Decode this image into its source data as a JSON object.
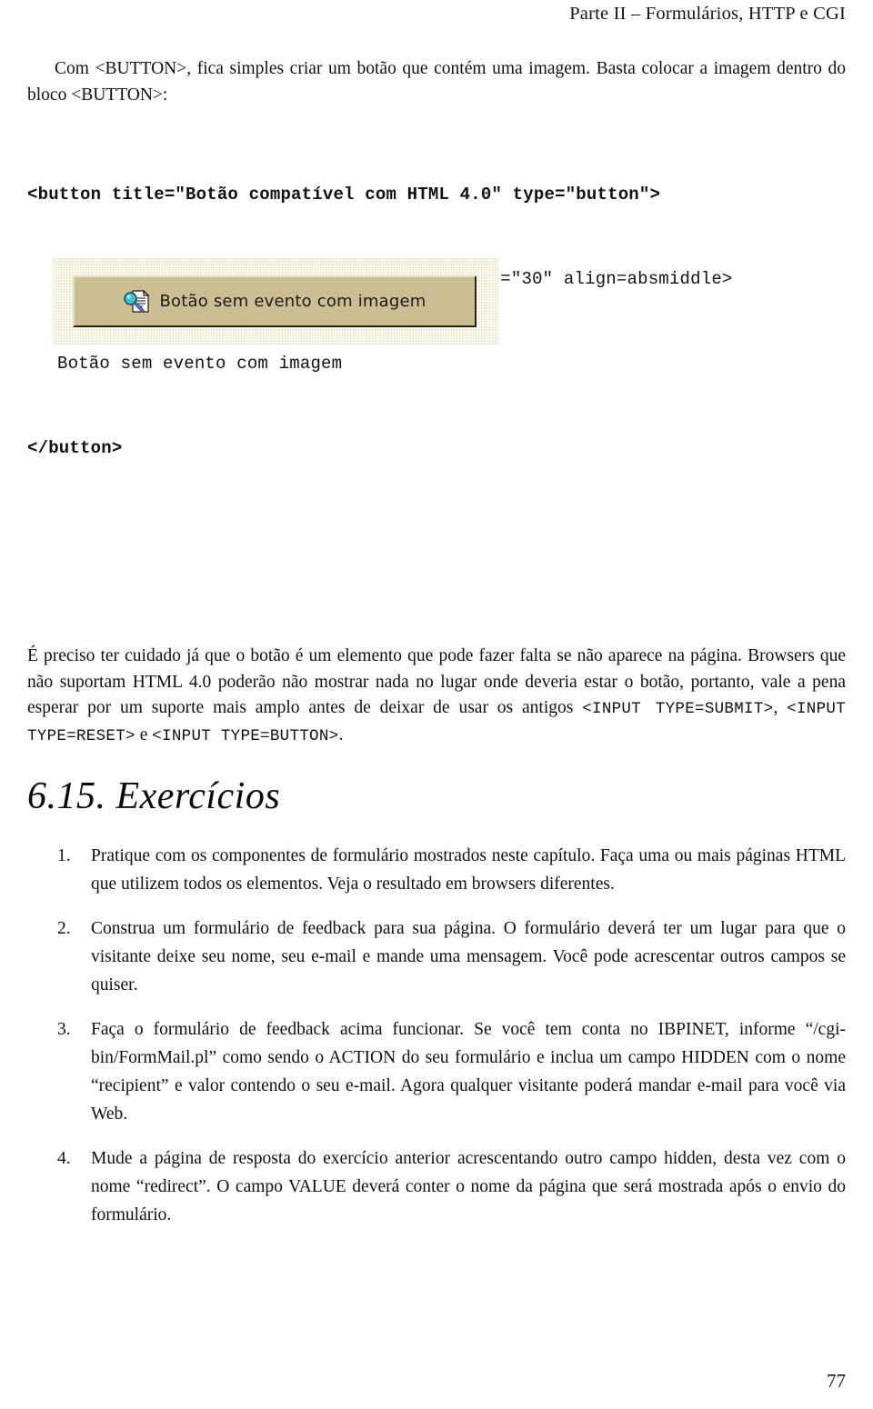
{
  "header": {
    "running_head": "Parte II – Formulários, HTTP e CGI"
  },
  "intro": {
    "paragraph": "Com <BUTTON>, fica simples criar um botão que contém uma imagem. Basta colocar a imagem dentro do bloco <BUTTON>:"
  },
  "code_block": {
    "line1": "<button title=\"Botão compatível com HTML 4.0\" type=\"button\">",
    "line2": "<img src=\"localizar.gif\" width=\"33\" height=\"30\" align=absmiddle>",
    "line3": "Botão sem evento com imagem",
    "line4": "</button>"
  },
  "screenshot": {
    "button_label": "Botão sem evento com imagem",
    "icon": "find-document-icon",
    "colors": {
      "page_background": "#f6f4e2",
      "button_face": "#cdbd92",
      "button_highlight": "#e6dcc2",
      "button_shadow": "#2a2418",
      "magnifier_glass": "#3fc3c8",
      "magnifier_handle": "#2b3fa8"
    }
  },
  "note": {
    "paragraph": "É preciso ter cuidado já que o botão é um elemento que pode fazer falta se não aparece na página. Browsers que não suportam HTML 4.0 poderão não mostrar nada no lugar onde deveria estar o botão, portanto, vale a pena esperar por um suporte mais amplo antes de deixar de usar os antigos ",
    "code1": "<INPUT TYPE=SUBMIT>",
    "sep1": ", ",
    "code2": "<INPUT TYPE=RESET>",
    "sep2": " e ",
    "code3": "<INPUT TYPE=BUTTON>",
    "sep3": "."
  },
  "section": {
    "heading": "6.15. Exercícios",
    "exercises": [
      {
        "number": "1.",
        "text": "Pratique com os componentes de formulário mostrados neste capítulo. Faça uma ou mais páginas HTML que utilizem todos os elementos. Veja o resultado em browsers diferentes."
      },
      {
        "number": "2.",
        "text": "Construa um formulário de feedback para sua página. O formulário deverá ter um lugar para que o visitante deixe seu nome, seu e-mail e mande uma mensagem. Você pode acrescentar outros campos se quiser."
      },
      {
        "number": "3.",
        "text": "Faça o formulário de feedback acima funcionar. Se você tem conta no IBPINET, informe “/cgi-bin/FormMail.pl” como sendo o ACTION do seu formulário e inclua um campo HIDDEN com o nome “recipient” e valor contendo o seu e-mail. Agora qualquer visitante poderá mandar e-mail para você via Web."
      },
      {
        "number": "4.",
        "text": "Mude a página de resposta do exercício anterior acrescentando outro campo hidden, desta vez com o nome “redirect”. O campo VALUE deverá conter o nome da página que será mostrada após o envio do formulário."
      }
    ]
  },
  "footer": {
    "page_number": "77"
  }
}
